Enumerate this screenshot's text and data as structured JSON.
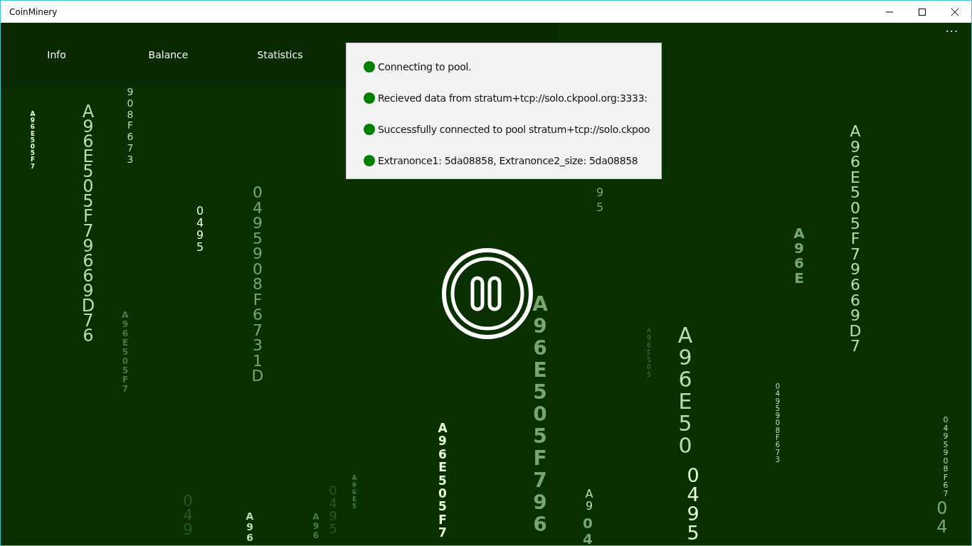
{
  "window": {
    "title": "CoinMinery"
  },
  "nav": {
    "items": [
      "Info",
      "Balance",
      "Statistics"
    ],
    "more": "···"
  },
  "log": [
    {
      "text": "Connecting to pool."
    },
    {
      "text": "Recieved data from stratum+tcp://solo.ckpool.org:3333:"
    },
    {
      "text": "Successfully connected to pool stratum+tcp://solo.ckpoo"
    },
    {
      "text": "Extranonce1: 5da08858, Extranonce2_size: 5da08858"
    }
  ],
  "rain": [
    {
      "text": "A96E505F7",
      "kind": "bold"
    },
    {
      "text": "A96E505F79669D76",
      "kind": "regular"
    },
    {
      "text": "908F673",
      "kind": "regular"
    },
    {
      "text": "0495",
      "kind": "regular"
    },
    {
      "text": "0495908F6731D",
      "kind": "regular"
    },
    {
      "text": "A96E505F7",
      "kind": "bold"
    },
    {
      "text": "049",
      "kind": "regular"
    },
    {
      "text": "A96",
      "kind": "bold"
    },
    {
      "text": "A96",
      "kind": "bold"
    },
    {
      "text": "0495",
      "kind": "regular"
    },
    {
      "text": "A96E5",
      "kind": "bold"
    },
    {
      "text": "A96E505F7",
      "kind": "bold"
    },
    {
      "text": "A96E505F796",
      "kind": "bold"
    },
    {
      "text": "95",
      "kind": "regular"
    },
    {
      "text": "A9",
      "kind": "regular"
    },
    {
      "text": "04",
      "kind": "bold"
    },
    {
      "text": "A96E505",
      "kind": "regular"
    },
    {
      "text": "A96E50",
      "kind": "regular"
    },
    {
      "text": "0495",
      "kind": "regular"
    },
    {
      "text": "A96E505F79669D7",
      "kind": "regular"
    },
    {
      "text": "A96E",
      "kind": "bold"
    },
    {
      "text": "0495908F673",
      "kind": "regular"
    },
    {
      "text": "0495908F67",
      "kind": "regular"
    },
    {
      "text": "04",
      "kind": "regular"
    }
  ]
}
